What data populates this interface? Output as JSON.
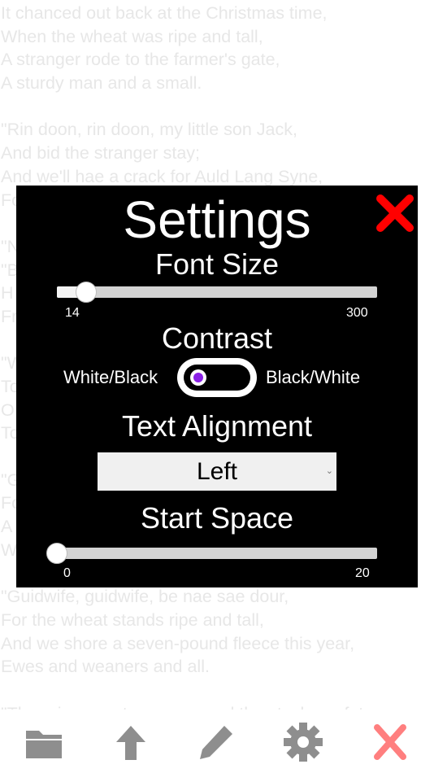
{
  "poem": {
    "lines": [
      "It chanced out back at the Christmas time,",
      "When the wheat was ripe and tall,",
      "A stranger rode to the farmer's gate,",
      "A sturdy man and a small.",
      "",
      "\"Rin doon, rin doon, my little son Jack,",
      "And bid the stranger stay;",
      "And we'll hae a crack for Auld Lang Syne,",
      "Fo",
      "",
      "\"N",
      "\"B",
      "H",
      "Fr",
      "",
      "\"W",
      "To",
      "O",
      "To",
      "",
      "\"G",
      "Fo",
      "A",
      "W",
      "",
      "\"Guidwife, guidwife, be nae sae dour,",
      "For the wheat stands ripe and tall,",
      "And we shore a seven-pound fleece this year,",
      "Ewes and weaners and all.",
      "",
      "\"There is grass tae spare, and the stock are fat"
    ]
  },
  "settings": {
    "title": "Settings",
    "font_size": {
      "label": "Font Size",
      "min": "14",
      "max": "300",
      "value": 40
    },
    "contrast": {
      "label": "Contrast",
      "left_option": "White/Black",
      "right_option": "Black/White",
      "selected": "White/Black"
    },
    "text_alignment": {
      "label": "Text Alignment",
      "selected": "Left"
    },
    "start_space": {
      "label": "Start Space",
      "min": "0",
      "max": "20",
      "value": 0
    }
  },
  "colors": {
    "close": "#ff0000",
    "toggle_dot": "#8a20e6",
    "toolbar_icon": "#8e8e8e",
    "toolbar_close": "#ff7f7f"
  },
  "toolbar": {
    "icons": [
      "folder-icon",
      "arrow-up-icon",
      "pencil-icon",
      "gear-icon",
      "close-icon"
    ]
  }
}
